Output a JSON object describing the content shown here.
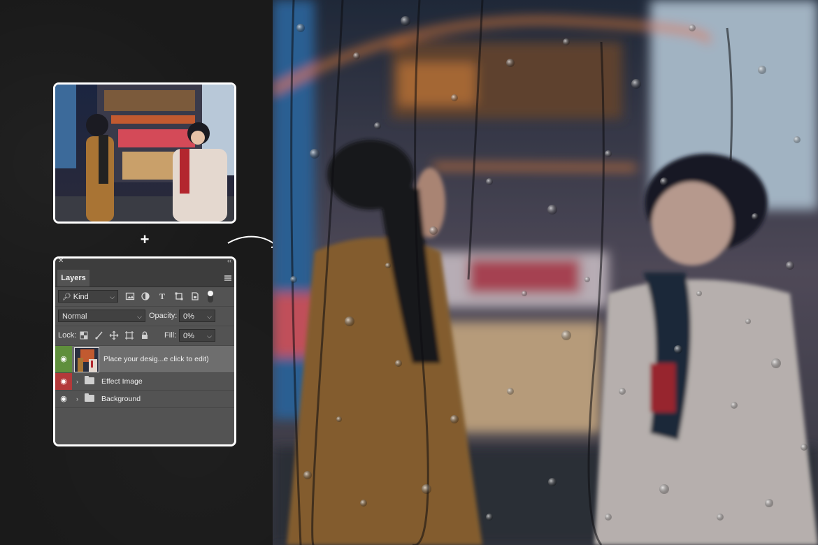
{
  "canvas": {
    "background": "#1b1b1b"
  },
  "composition": {
    "plus_symbol": "+",
    "source_photo_alt": "night-street-photo",
    "result_photo_alt": "rain-on-glass-result-photo"
  },
  "layers_panel": {
    "close_glyph": "✕",
    "collapse_glyph": "‹‹",
    "tab_label": "Layers",
    "filter": {
      "kind_value": "Kind",
      "icons": [
        "image-filter-icon",
        "adjustment-filter-icon",
        "type-filter-icon",
        "shape-filter-icon",
        "smart-object-filter-icon"
      ]
    },
    "blend_mode": "Normal",
    "opacity_label": "Opacity:",
    "opacity_value": "0%",
    "lock_label": "Lock:",
    "lock_icons": [
      "lock-transparent-icon",
      "lock-image-icon",
      "lock-position-icon",
      "lock-artboard-icon",
      "lock-all-icon"
    ],
    "fill_label": "Fill:",
    "fill_value": "0%",
    "layers": [
      {
        "name": "Place your desig...e click to edit)",
        "visible_color": "#5f8f3c",
        "selected": true,
        "type": "smart-object"
      },
      {
        "name": "Effect Image",
        "visible_color": "#b3393a",
        "selected": false,
        "type": "group"
      },
      {
        "name": "Background",
        "visible_color": "#535353",
        "selected": false,
        "type": "group"
      }
    ]
  }
}
